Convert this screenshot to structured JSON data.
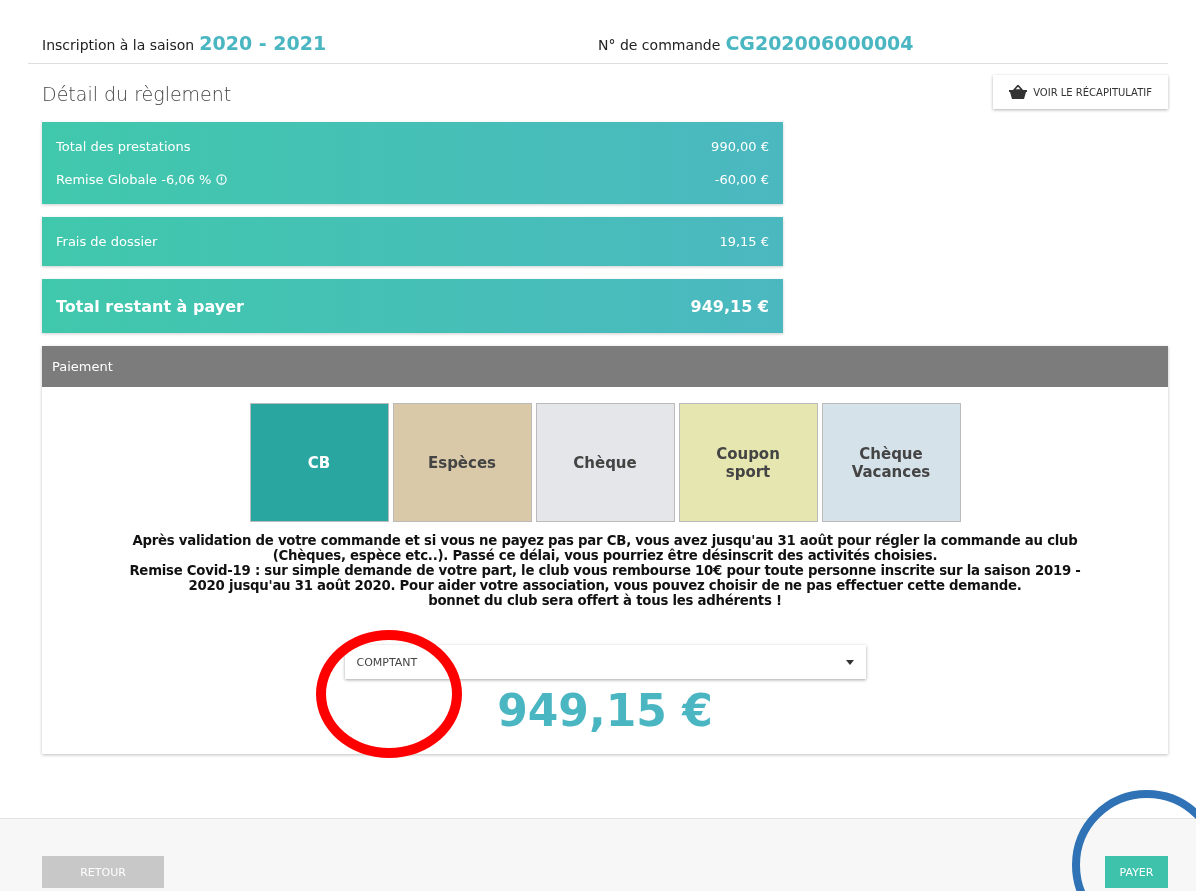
{
  "header": {
    "season_label": "Inscription à la saison",
    "season": "2020 - 2021",
    "order_label": "N° de commande",
    "order_number": "CG202006000004"
  },
  "detail": {
    "title": "Détail du règlement",
    "summary_button": "VOIR LE RÉCAPITULATIF",
    "cards": [
      {
        "kind": "rows",
        "rows": [
          {
            "label": "Total des prestations",
            "info": false,
            "amount": "990,00 €"
          },
          {
            "label": "Remise Globale -6,06  %",
            "info": true,
            "amount": "-60,00 €"
          }
        ]
      },
      {
        "kind": "rows",
        "rows": [
          {
            "label": "Frais de dossier",
            "info": false,
            "amount": "19,15 €"
          }
        ]
      },
      {
        "kind": "total",
        "rows": [
          {
            "label": "Total restant à payer",
            "info": false,
            "amount": "949,15 €"
          }
        ]
      }
    ]
  },
  "payment": {
    "title": "Paiement",
    "methods": [
      {
        "label": "CB",
        "selected": true,
        "color": "#2aa6a0"
      },
      {
        "label": "Espèces",
        "selected": false,
        "color": "#d9c9a8"
      },
      {
        "label": "Chèque",
        "selected": false,
        "color": "#e4e6ea"
      },
      {
        "label": "Coupon sport",
        "selected": false,
        "color": "#e6e7b0"
      },
      {
        "label": "Chèque Vacances",
        "selected": false,
        "color": "#d6e2ea"
      }
    ],
    "notice_lines": [
      "Après validation de votre commande et si vous ne payez pas par CB, vous avez jusqu'au 31 août pour régler la commande au club",
      "(Chèques, espèce etc..). Passé ce délai, vous pourriez être désinscrit des activités choisies.",
      "Remise Covid-19 : sur simple demande de votre part, le club vous rembourse 10€ pour toute personne inscrite sur la saison 2019 -",
      "2020 jusqu'au 31 août 2020. Pour aider votre association, vous pouvez choisir de ne pas effectuer cette demande.",
      "bonnet du club sera offert à tous les adhérents !"
    ],
    "select_value": "COMPTANT",
    "amount": "949,15 €"
  },
  "footer": {
    "back_button": {
      "label": "RETOUR",
      "disabled": true
    },
    "pay_button": {
      "label": "PAYER",
      "disabled": false
    }
  }
}
